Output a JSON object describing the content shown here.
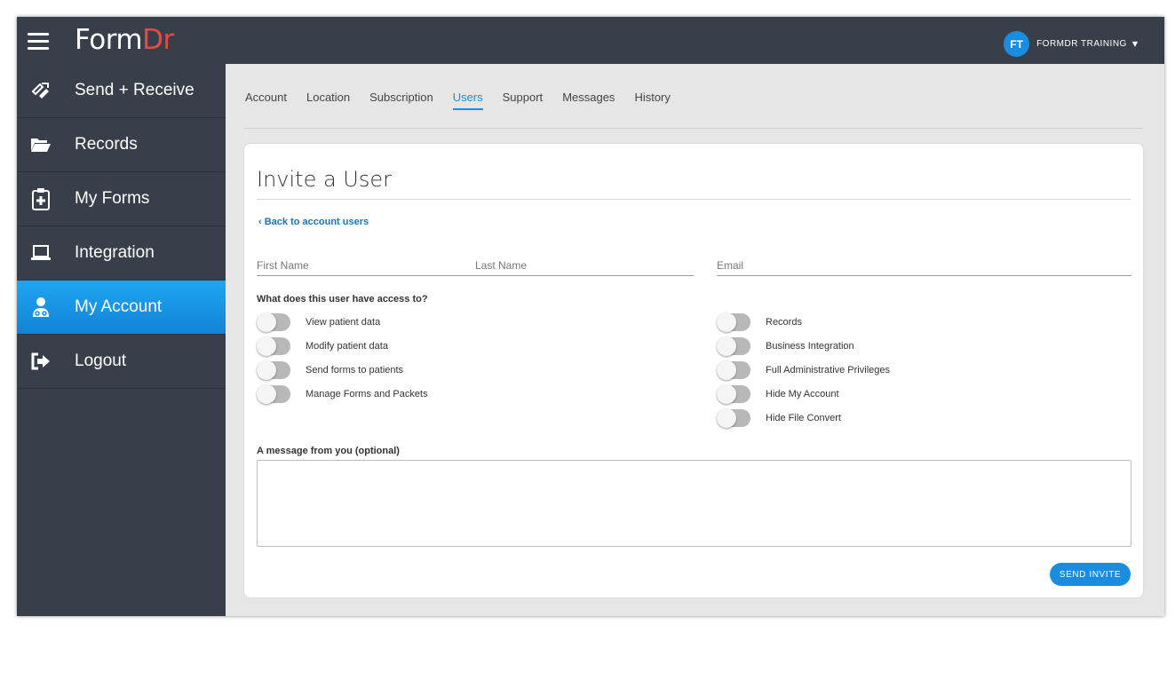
{
  "header": {
    "logo_part1": "Form",
    "logo_part2": "Dr",
    "user_initials": "FT",
    "user_name": "FORMDR TRAINING",
    "caret": "▼"
  },
  "sidebar": {
    "items": [
      {
        "label": "Send + Receive",
        "icon": "send-receive-icon"
      },
      {
        "label": "Records",
        "icon": "folder-icon"
      },
      {
        "label": "My Forms",
        "icon": "clipboard-icon"
      },
      {
        "label": "Integration",
        "icon": "laptop-icon"
      },
      {
        "label": "My Account",
        "icon": "doctor-icon",
        "active": true
      },
      {
        "label": "Logout",
        "icon": "logout-icon"
      }
    ]
  },
  "tabs": [
    {
      "label": "Account"
    },
    {
      "label": "Location"
    },
    {
      "label": "Subscription"
    },
    {
      "label": "Users",
      "active": true
    },
    {
      "label": "Support"
    },
    {
      "label": "Messages"
    },
    {
      "label": "History"
    }
  ],
  "form": {
    "title": "Invite a User",
    "back_link": "Back to account users",
    "first_name_placeholder": "First Name",
    "last_name_placeholder": "Last Name",
    "email_placeholder": "Email",
    "access_label": "What does this user have access to?",
    "permissions_left": [
      {
        "label": "View patient data",
        "on": false
      },
      {
        "label": "Modify patient data",
        "on": false
      },
      {
        "label": "Send forms to patients",
        "on": false
      },
      {
        "label": "Manage Forms and Packets",
        "on": false
      }
    ],
    "permissions_right": [
      {
        "label": "Records",
        "on": false
      },
      {
        "label": "Business Integration",
        "on": false
      },
      {
        "label": "Full Administrative Privileges",
        "on": false
      },
      {
        "label": "Hide My Account",
        "on": false
      },
      {
        "label": "Hide File Convert",
        "on": false
      }
    ],
    "message_label": "A message from you (optional)",
    "message_value": "",
    "send_button": "SEND INVITE"
  },
  "colors": {
    "sidebar_bg": "#383f4a",
    "accent": "#1a8de0",
    "logo_dr": "#e64c3c"
  }
}
